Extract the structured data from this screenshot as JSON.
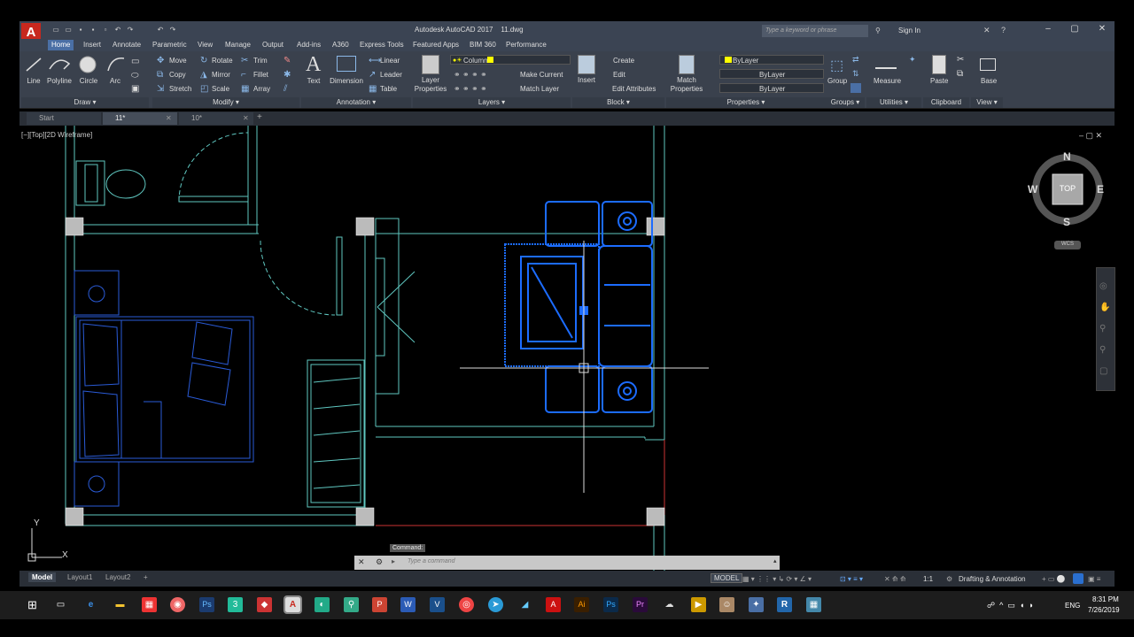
{
  "app": {
    "title": "Autodesk AutoCAD 2017",
    "file": "11.dwg",
    "logo": "A",
    "search_placeholder": "Type a keyword or phrase",
    "sign_in": "Sign In"
  },
  "ribbon_tabs": [
    "Home",
    "Insert",
    "Annotate",
    "Parametric",
    "View",
    "Manage",
    "Output",
    "Add-ins",
    "A360",
    "Express Tools",
    "Featured Apps",
    "BIM 360",
    "Performance"
  ],
  "draw": {
    "line": "Line",
    "polyline": "Polyline",
    "circle": "Circle",
    "arc": "Arc",
    "panel": "Draw ▾"
  },
  "modify": {
    "move": "Move",
    "rotate": "Rotate",
    "trim": "Trim",
    "copy": "Copy",
    "mirror": "Mirror",
    "fillet": "Fillet",
    "stretch": "Stretch",
    "scale": "Scale",
    "array": "Array",
    "panel": "Modify ▾"
  },
  "annotation": {
    "text": "Text",
    "dimension": "Dimension",
    "linear": "Linear",
    "leader": "Leader",
    "table": "Table",
    "panel": "Annotation ▾"
  },
  "layers": {
    "layer_properties": "Layer Properties",
    "current_layer": "Column",
    "make_current": "Make Current",
    "match_layer": "Match Layer",
    "panel": "Layers ▾"
  },
  "block": {
    "insert": "Insert",
    "create": "Create",
    "edit": "Edit",
    "edit_attributes": "Edit Attributes",
    "panel": "Block ▾"
  },
  "properties": {
    "match": "Match Properties",
    "color": "ByLayer",
    "linetype": "ByLayer",
    "lineweight": "ByLayer",
    "panel": "Properties ▾"
  },
  "groups": {
    "group": "Group",
    "panel": "Groups ▾"
  },
  "utilities": {
    "measure": "Measure",
    "panel": "Utilities ▾"
  },
  "clipboard": {
    "paste": "Paste",
    "panel": "Clipboard"
  },
  "view": {
    "base": "Base",
    "panel": "View ▾"
  },
  "doc_tabs": [
    "Start",
    "11*",
    "10*"
  ],
  "viewport_label": "[−][Top][2D Wireframe]",
  "navcube": {
    "top": "TOP",
    "n": "N",
    "s": "S",
    "e": "E",
    "w": "W",
    "ucs": "WCS"
  },
  "ucs": {
    "x": "X",
    "y": "Y"
  },
  "command": {
    "history": "Command:",
    "placeholder": "Type a command"
  },
  "layout_tabs": [
    "Model",
    "Layout1",
    "Layout2"
  ],
  "status": {
    "model": "MODEL",
    "scale": "1:1",
    "workspace": "Drafting & Annotation"
  },
  "taskbar": {
    "time": "8:31 PM",
    "date": "7/26/2019",
    "lang": "ENG"
  },
  "colors": {
    "accent": "#4a6fa5",
    "wall": "#5fc7c0",
    "furniture": "#1c6cff",
    "autocad_red": "#c8281e"
  }
}
